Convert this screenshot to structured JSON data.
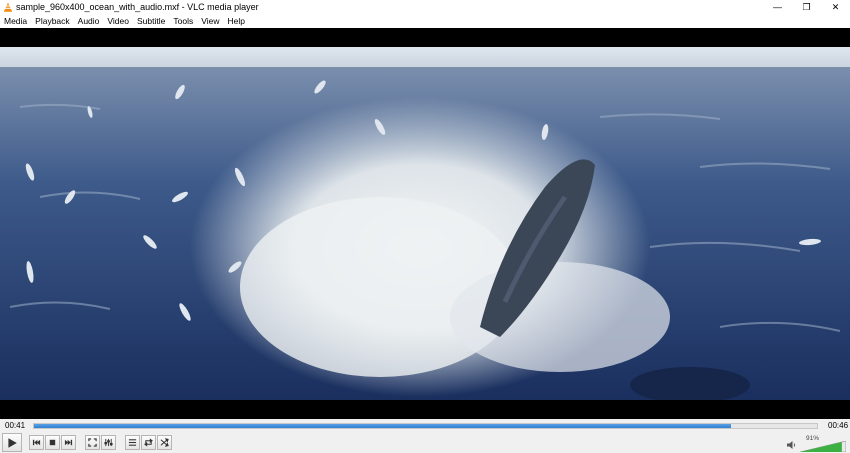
{
  "window": {
    "title": "sample_960x400_ocean_with_audio.mxf - VLC media player",
    "minimize": "—",
    "maximize": "❐",
    "close": "✕"
  },
  "menu": [
    "Media",
    "Playback",
    "Audio",
    "Video",
    "Subtitle",
    "Tools",
    "View",
    "Help"
  ],
  "playback": {
    "elapsed": "00:41",
    "total": "00:46",
    "progress": 0.89
  },
  "volume": {
    "label": "91%",
    "level": 0.91
  },
  "colors": {
    "accent": "#2f7fd2",
    "volume_green": "#3cb043",
    "vlc_orange": "#f28c13"
  },
  "icons": [
    "vlc-cone-icon",
    "play-icon",
    "previous-icon",
    "stop-icon",
    "next-icon",
    "fullscreen-icon",
    "extended-settings-icon",
    "playlist-icon",
    "loop-icon",
    "shuffle-icon",
    "speaker-icon"
  ]
}
